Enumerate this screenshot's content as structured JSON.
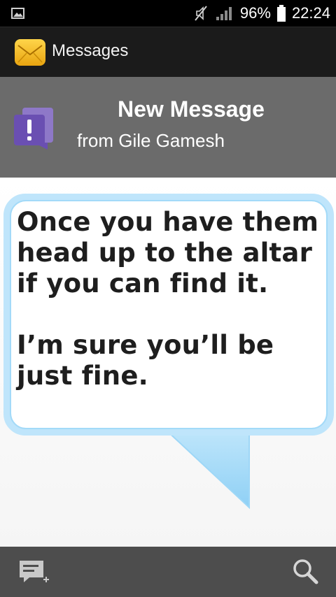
{
  "status_bar": {
    "battery": "96%",
    "time": "22:24"
  },
  "app_bar": {
    "title": "Messages"
  },
  "notification": {
    "title": "New Message",
    "sender": "from Gile Gamesh"
  },
  "message": {
    "paragraphs": [
      "Once you have them head up to the altar if you can find it.",
      "I’m sure you’ll be just fine."
    ]
  },
  "icons": {
    "status_left": "image-icon",
    "mute": "mute-icon",
    "signal": "signal-icon",
    "battery": "battery-icon",
    "app": "envelope-icon",
    "notification": "alert-message-icon",
    "compose": "compose-message-icon",
    "search": "search-icon"
  },
  "colors": {
    "app_bar": "#1b1b1b",
    "notification_bg": "#6b6b6b",
    "bubble_border": "#a9dcf8",
    "bottom_bar": "#4d4d4d"
  }
}
